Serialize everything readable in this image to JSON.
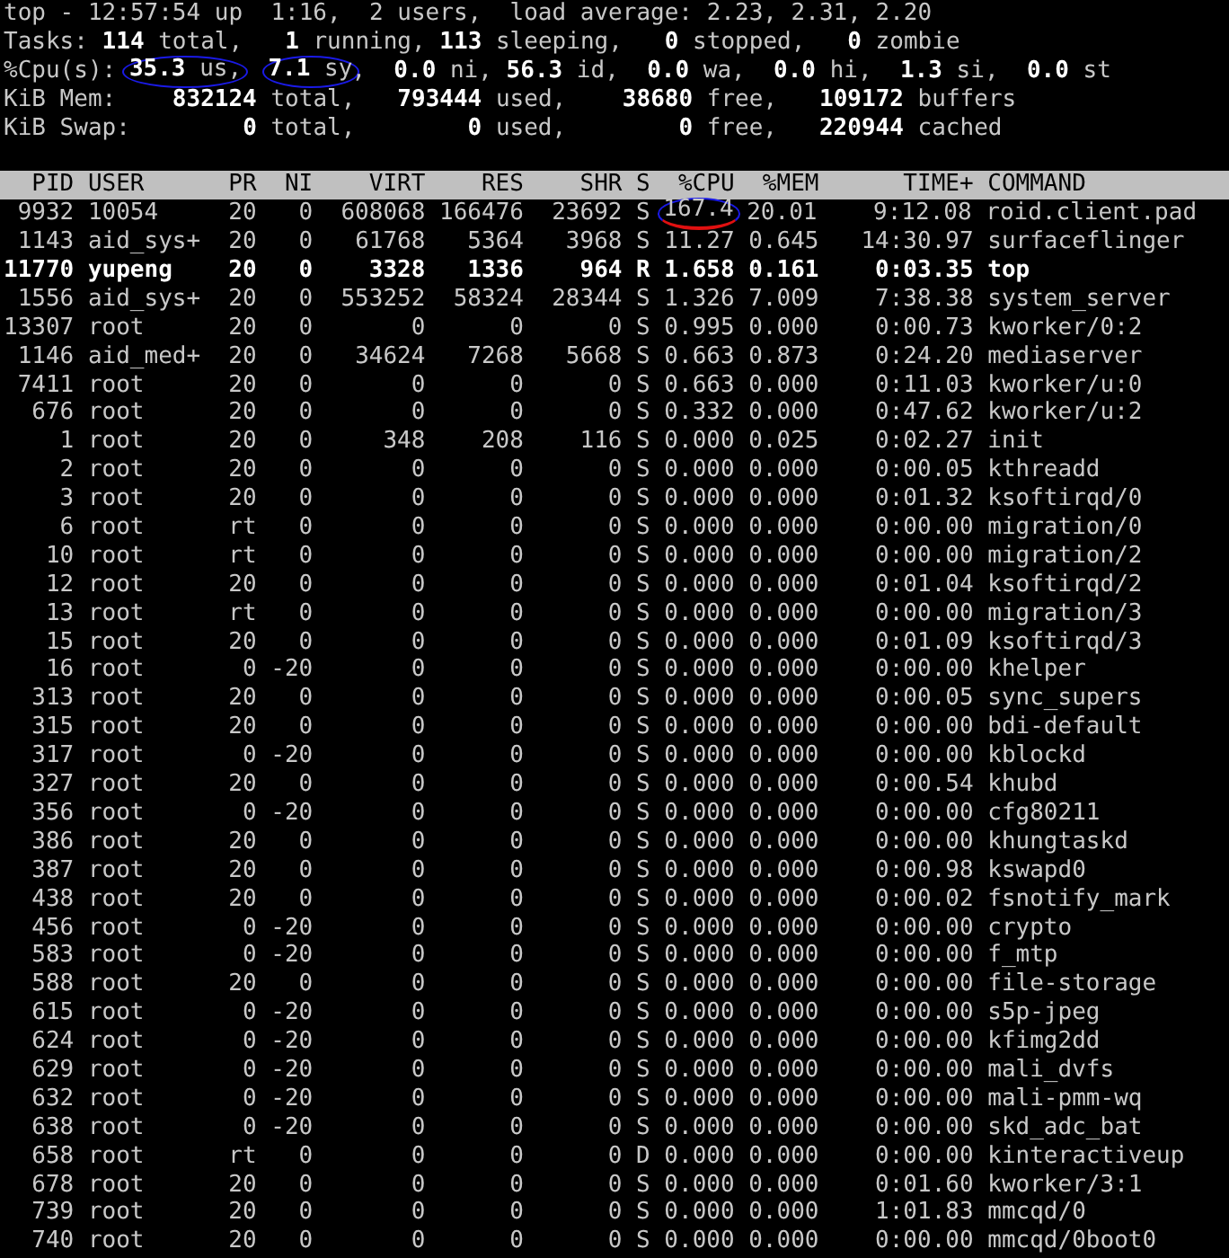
{
  "summary": [
    [
      {
        "text": "top - 12:57:54 up  1:16,  2 users,  load average: 2.23, 2.31, 2.20",
        "circled": false
      }
    ],
    [
      {
        "text": "Tasks: **114** total,   **1** running, **113** sleeping,   **0** stopped,   **0** zombie",
        "circled": false
      }
    ],
    [
      {
        "text": "%Cpu(s): ",
        "circled": false
      },
      {
        "text": "**35.3** us,",
        "circled": true
      },
      {
        "text": "**7.1** sy",
        "circled": true
      },
      {
        "text": ",  **0.0** ni, **56.3** id,  **0.0** wa,  **0.0** hi,  **1.3** si,  **0.0** st",
        "circled": false
      }
    ],
    [
      {
        "text": "KiB Mem:    **832124** total,   **793444** used,    **38680** free,   **109172** buffers",
        "circled": false
      }
    ],
    [
      {
        "text": "KiB Swap:        **0** total,        **0** used,        **0** free,   **220944** cached",
        "circled": false
      }
    ]
  ],
  "columns": [
    "PID",
    "USER",
    "PR",
    "NI",
    "VIRT",
    "RES",
    "SHR",
    "S",
    "%CPU",
    "%MEM",
    "TIME+",
    "COMMAND"
  ],
  "rows": [
    {
      "cells": [
        "9932",
        "10054",
        "20",
        "0",
        "608068",
        "166476",
        "23692",
        "S",
        "167.4",
        "20.01",
        "9:12.08",
        "roid.client.pad"
      ],
      "highlighted": false,
      "cpu_annotated": true
    },
    {
      "cells": [
        "1143",
        "aid_sys+",
        "20",
        "0",
        "61768",
        "5364",
        "3968",
        "S",
        "11.27",
        "0.645",
        "14:30.97",
        "surfaceflinger"
      ],
      "highlighted": false,
      "cpu_annotated": false
    },
    {
      "cells": [
        "11770",
        "yupeng",
        "20",
        "0",
        "3328",
        "1336",
        "964",
        "R",
        "1.658",
        "0.161",
        "0:03.35",
        "top"
      ],
      "highlighted": true,
      "cpu_annotated": false
    },
    {
      "cells": [
        "1556",
        "aid_sys+",
        "20",
        "0",
        "553252",
        "58324",
        "28344",
        "S",
        "1.326",
        "7.009",
        "7:38.38",
        "system_server"
      ],
      "highlighted": false,
      "cpu_annotated": false
    },
    {
      "cells": [
        "13307",
        "root",
        "20",
        "0",
        "0",
        "0",
        "0",
        "S",
        "0.995",
        "0.000",
        "0:00.73",
        "kworker/0:2"
      ],
      "highlighted": false,
      "cpu_annotated": false
    },
    {
      "cells": [
        "1146",
        "aid_med+",
        "20",
        "0",
        "34624",
        "7268",
        "5668",
        "S",
        "0.663",
        "0.873",
        "0:24.20",
        "mediaserver"
      ],
      "highlighted": false,
      "cpu_annotated": false
    },
    {
      "cells": [
        "7411",
        "root",
        "20",
        "0",
        "0",
        "0",
        "0",
        "S",
        "0.663",
        "0.000",
        "0:11.03",
        "kworker/u:0"
      ],
      "highlighted": false,
      "cpu_annotated": false
    },
    {
      "cells": [
        "676",
        "root",
        "20",
        "0",
        "0",
        "0",
        "0",
        "S",
        "0.332",
        "0.000",
        "0:47.62",
        "kworker/u:2"
      ],
      "highlighted": false,
      "cpu_annotated": false
    },
    {
      "cells": [
        "1",
        "root",
        "20",
        "0",
        "348",
        "208",
        "116",
        "S",
        "0.000",
        "0.025",
        "0:02.27",
        "init"
      ],
      "highlighted": false,
      "cpu_annotated": false
    },
    {
      "cells": [
        "2",
        "root",
        "20",
        "0",
        "0",
        "0",
        "0",
        "S",
        "0.000",
        "0.000",
        "0:00.05",
        "kthreadd"
      ],
      "highlighted": false,
      "cpu_annotated": false
    },
    {
      "cells": [
        "3",
        "root",
        "20",
        "0",
        "0",
        "0",
        "0",
        "S",
        "0.000",
        "0.000",
        "0:01.32",
        "ksoftirqd/0"
      ],
      "highlighted": false,
      "cpu_annotated": false
    },
    {
      "cells": [
        "6",
        "root",
        "rt",
        "0",
        "0",
        "0",
        "0",
        "S",
        "0.000",
        "0.000",
        "0:00.00",
        "migration/0"
      ],
      "highlighted": false,
      "cpu_annotated": false
    },
    {
      "cells": [
        "10",
        "root",
        "rt",
        "0",
        "0",
        "0",
        "0",
        "S",
        "0.000",
        "0.000",
        "0:00.00",
        "migration/2"
      ],
      "highlighted": false,
      "cpu_annotated": false
    },
    {
      "cells": [
        "12",
        "root",
        "20",
        "0",
        "0",
        "0",
        "0",
        "S",
        "0.000",
        "0.000",
        "0:01.04",
        "ksoftirqd/2"
      ],
      "highlighted": false,
      "cpu_annotated": false
    },
    {
      "cells": [
        "13",
        "root",
        "rt",
        "0",
        "0",
        "0",
        "0",
        "S",
        "0.000",
        "0.000",
        "0:00.00",
        "migration/3"
      ],
      "highlighted": false,
      "cpu_annotated": false
    },
    {
      "cells": [
        "15",
        "root",
        "20",
        "0",
        "0",
        "0",
        "0",
        "S",
        "0.000",
        "0.000",
        "0:01.09",
        "ksoftirqd/3"
      ],
      "highlighted": false,
      "cpu_annotated": false
    },
    {
      "cells": [
        "16",
        "root",
        "0",
        "-20",
        "0",
        "0",
        "0",
        "S",
        "0.000",
        "0.000",
        "0:00.00",
        "khelper"
      ],
      "highlighted": false,
      "cpu_annotated": false
    },
    {
      "cells": [
        "313",
        "root",
        "20",
        "0",
        "0",
        "0",
        "0",
        "S",
        "0.000",
        "0.000",
        "0:00.05",
        "sync_supers"
      ],
      "highlighted": false,
      "cpu_annotated": false
    },
    {
      "cells": [
        "315",
        "root",
        "20",
        "0",
        "0",
        "0",
        "0",
        "S",
        "0.000",
        "0.000",
        "0:00.00",
        "bdi-default"
      ],
      "highlighted": false,
      "cpu_annotated": false
    },
    {
      "cells": [
        "317",
        "root",
        "0",
        "-20",
        "0",
        "0",
        "0",
        "S",
        "0.000",
        "0.000",
        "0:00.00",
        "kblockd"
      ],
      "highlighted": false,
      "cpu_annotated": false
    },
    {
      "cells": [
        "327",
        "root",
        "20",
        "0",
        "0",
        "0",
        "0",
        "S",
        "0.000",
        "0.000",
        "0:00.54",
        "khubd"
      ],
      "highlighted": false,
      "cpu_annotated": false
    },
    {
      "cells": [
        "356",
        "root",
        "0",
        "-20",
        "0",
        "0",
        "0",
        "S",
        "0.000",
        "0.000",
        "0:00.00",
        "cfg80211"
      ],
      "highlighted": false,
      "cpu_annotated": false
    },
    {
      "cells": [
        "386",
        "root",
        "20",
        "0",
        "0",
        "0",
        "0",
        "S",
        "0.000",
        "0.000",
        "0:00.00",
        "khungtaskd"
      ],
      "highlighted": false,
      "cpu_annotated": false
    },
    {
      "cells": [
        "387",
        "root",
        "20",
        "0",
        "0",
        "0",
        "0",
        "S",
        "0.000",
        "0.000",
        "0:00.98",
        "kswapd0"
      ],
      "highlighted": false,
      "cpu_annotated": false
    },
    {
      "cells": [
        "438",
        "root",
        "20",
        "0",
        "0",
        "0",
        "0",
        "S",
        "0.000",
        "0.000",
        "0:00.02",
        "fsnotify_mark"
      ],
      "highlighted": false,
      "cpu_annotated": false
    },
    {
      "cells": [
        "456",
        "root",
        "0",
        "-20",
        "0",
        "0",
        "0",
        "S",
        "0.000",
        "0.000",
        "0:00.00",
        "crypto"
      ],
      "highlighted": false,
      "cpu_annotated": false
    },
    {
      "cells": [
        "583",
        "root",
        "0",
        "-20",
        "0",
        "0",
        "0",
        "S",
        "0.000",
        "0.000",
        "0:00.00",
        "f_mtp"
      ],
      "highlighted": false,
      "cpu_annotated": false
    },
    {
      "cells": [
        "588",
        "root",
        "20",
        "0",
        "0",
        "0",
        "0",
        "S",
        "0.000",
        "0.000",
        "0:00.00",
        "file-storage"
      ],
      "highlighted": false,
      "cpu_annotated": false
    },
    {
      "cells": [
        "615",
        "root",
        "0",
        "-20",
        "0",
        "0",
        "0",
        "S",
        "0.000",
        "0.000",
        "0:00.00",
        "s5p-jpeg"
      ],
      "highlighted": false,
      "cpu_annotated": false
    },
    {
      "cells": [
        "624",
        "root",
        "0",
        "-20",
        "0",
        "0",
        "0",
        "S",
        "0.000",
        "0.000",
        "0:00.00",
        "kfimg2dd"
      ],
      "highlighted": false,
      "cpu_annotated": false
    },
    {
      "cells": [
        "629",
        "root",
        "0",
        "-20",
        "0",
        "0",
        "0",
        "S",
        "0.000",
        "0.000",
        "0:00.00",
        "mali_dvfs"
      ],
      "highlighted": false,
      "cpu_annotated": false
    },
    {
      "cells": [
        "632",
        "root",
        "0",
        "-20",
        "0",
        "0",
        "0",
        "S",
        "0.000",
        "0.000",
        "0:00.00",
        "mali-pmm-wq"
      ],
      "highlighted": false,
      "cpu_annotated": false
    },
    {
      "cells": [
        "638",
        "root",
        "0",
        "-20",
        "0",
        "0",
        "0",
        "S",
        "0.000",
        "0.000",
        "0:00.00",
        "skd_adc_bat"
      ],
      "highlighted": false,
      "cpu_annotated": false
    },
    {
      "cells": [
        "658",
        "root",
        "rt",
        "0",
        "0",
        "0",
        "0",
        "D",
        "0.000",
        "0.000",
        "0:00.00",
        "kinteractiveup"
      ],
      "highlighted": false,
      "cpu_annotated": false
    },
    {
      "cells": [
        "678",
        "root",
        "20",
        "0",
        "0",
        "0",
        "0",
        "S",
        "0.000",
        "0.000",
        "0:01.60",
        "kworker/3:1"
      ],
      "highlighted": false,
      "cpu_annotated": false
    },
    {
      "cells": [
        "739",
        "root",
        "20",
        "0",
        "0",
        "0",
        "0",
        "S",
        "0.000",
        "0.000",
        "1:01.83",
        "mmcqd/0"
      ],
      "highlighted": false,
      "cpu_annotated": false
    },
    {
      "cells": [
        "740",
        "root",
        "20",
        "0",
        "0",
        "0",
        "0",
        "S",
        "0.000",
        "0.000",
        "0:00.00",
        "mmcqd/0boot0"
      ],
      "highlighted": false,
      "cpu_annotated": false
    }
  ]
}
